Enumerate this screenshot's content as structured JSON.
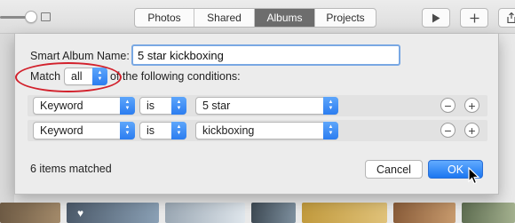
{
  "toolbar": {
    "tabs": [
      {
        "label": "Photos",
        "active": false
      },
      {
        "label": "Shared",
        "active": false
      },
      {
        "label": "Albums",
        "active": true
      },
      {
        "label": "Projects",
        "active": false
      }
    ],
    "play_icon": "play-icon",
    "add_icon": "plus-icon",
    "share_icon": "share-icon"
  },
  "dialog": {
    "name_label": "Smart Album Name:",
    "name_value": "5 star kickboxing",
    "match_label": "Match",
    "match_value": "all",
    "match_suffix": "of the following conditions:",
    "conditions": [
      {
        "field": "Keyword",
        "operator": "is",
        "value": "5 star"
      },
      {
        "field": "Keyword",
        "operator": "is",
        "value": "kickboxing"
      }
    ],
    "status": "6 items matched",
    "cancel_label": "Cancel",
    "ok_label": "OK"
  },
  "colors": {
    "accent": "#2b7df0",
    "annotation": "#d2212c",
    "active_tab": "#6d6d6d"
  }
}
